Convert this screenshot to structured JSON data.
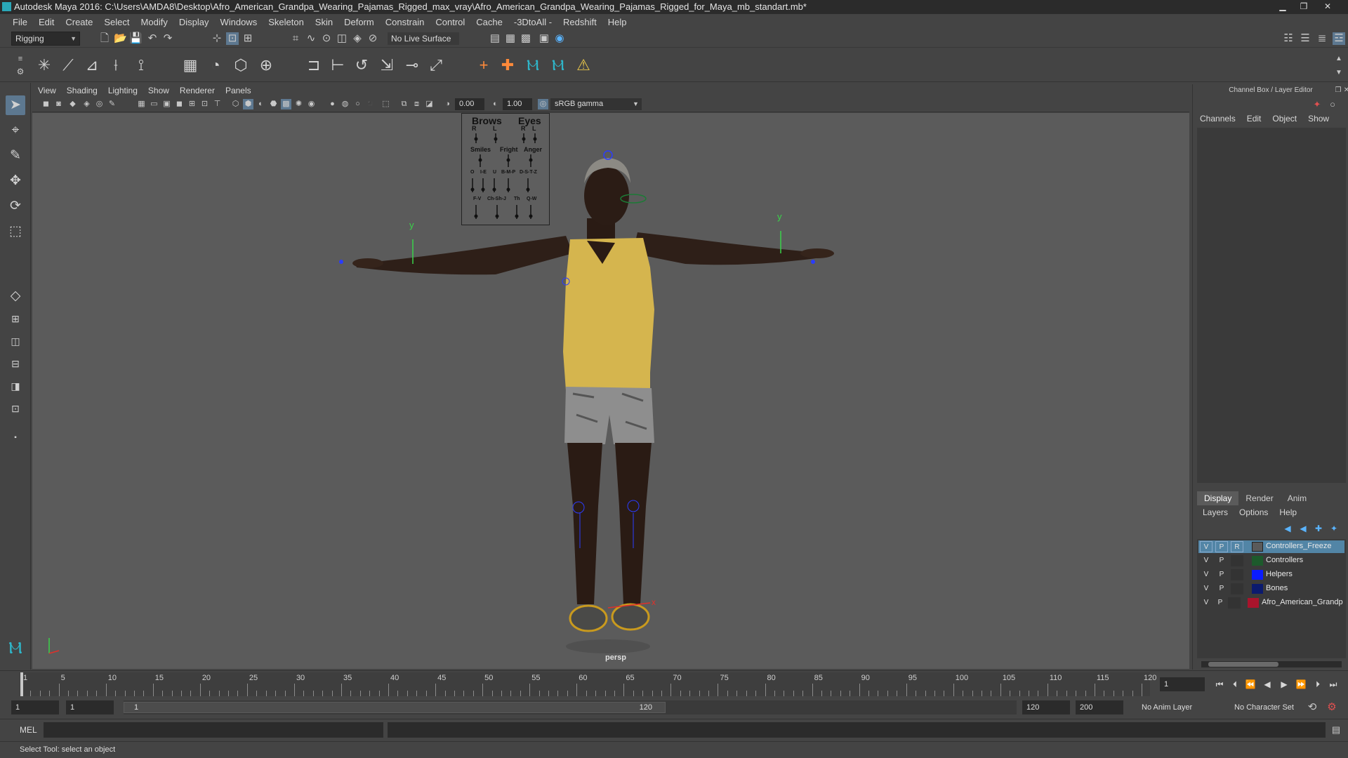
{
  "window": {
    "title": "Autodesk Maya 2016: C:\\Users\\AMDA8\\Desktop\\Afro_American_Grandpa_Wearing_Pajamas_Rigged_max_vray\\Afro_American_Grandpa_Wearing_Pajamas_Rigged_for_Maya_mb_standart.mb*"
  },
  "menubar": [
    "File",
    "Edit",
    "Create",
    "Select",
    "Modify",
    "Display",
    "Windows",
    "Skeleton",
    "Skin",
    "Deform",
    "Constrain",
    "Control",
    "Cache",
    "-3DtoAll -",
    "Redshift",
    "Help"
  ],
  "statusline": {
    "menuset": "Rigging",
    "live_surface": "No Live Surface"
  },
  "panel": {
    "menu": [
      "View",
      "Shading",
      "Lighting",
      "Show",
      "Renderer",
      "Panels"
    ],
    "exposure": "0.00",
    "gamma": "1.00",
    "color_space": "sRGB gamma",
    "camera_label": "persp"
  },
  "face_panel": {
    "brows": "Brows",
    "eyes": "Eyes",
    "r1": "R",
    "l1": "L",
    "r2": "R",
    "l2": "L",
    "smiles": "Smiles",
    "fright": "Fright",
    "anger": "Anger",
    "row3": [
      "O",
      "I-E",
      "U",
      "B-M-P",
      "D-S-T-Z"
    ],
    "row4": [
      "F-V",
      "Ch-Sh-J",
      "Th",
      "Q-W"
    ]
  },
  "axes": {
    "y": "y",
    "x": "x"
  },
  "channel_box": {
    "title": "Channel Box / Layer Editor",
    "menu": [
      "Channels",
      "Edit",
      "Object",
      "Show"
    ]
  },
  "layer_editor": {
    "tabs": [
      "Display",
      "Render",
      "Anim"
    ],
    "menu": [
      "Layers",
      "Options",
      "Help"
    ],
    "layers": [
      {
        "v": "V",
        "p": "P",
        "r": "R",
        "name": "Controllers_Freeze",
        "color": "#5a5a5a"
      },
      {
        "v": "V",
        "p": "P",
        "r": "",
        "name": "Controllers",
        "color": "#1d5a2c"
      },
      {
        "v": "V",
        "p": "P",
        "r": "",
        "name": "Helpers",
        "color": "#0a1cff"
      },
      {
        "v": "V",
        "p": "P",
        "r": "",
        "name": "Bones",
        "color": "#0b1a6e"
      },
      {
        "v": "V",
        "p": "P",
        "r": "",
        "name": "Afro_American_Grandp",
        "color": "#a8142c"
      }
    ]
  },
  "timeline": {
    "ticks": [
      "1",
      "5",
      "10",
      "15",
      "20",
      "25",
      "30",
      "35",
      "40",
      "45",
      "50",
      "55",
      "60",
      "65",
      "70",
      "75",
      "80",
      "85",
      "90",
      "95",
      "100",
      "105",
      "110",
      "115",
      "120"
    ],
    "current_frame": "1"
  },
  "range": {
    "start": "1",
    "playback_start": "1",
    "slider_start": "1",
    "slider_end": "120",
    "playback_end": "120",
    "end": "200",
    "anim_layer": "No Anim Layer",
    "character_set": "No Character Set"
  },
  "command_line": {
    "label": "MEL"
  },
  "help_line": {
    "text": "Select Tool: select an object"
  }
}
